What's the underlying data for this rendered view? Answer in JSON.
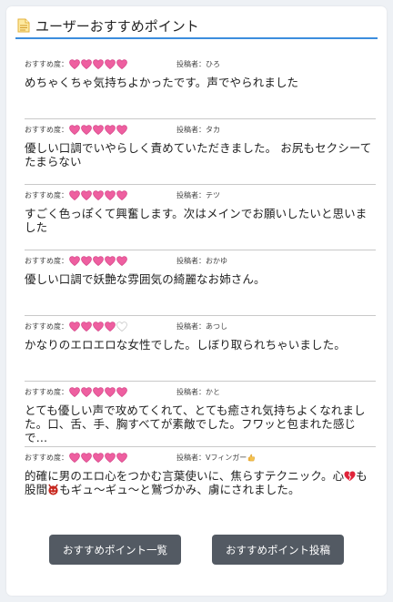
{
  "header": {
    "title": "ユーザーおすすめポイント",
    "icon": "document-icon"
  },
  "colors": {
    "accent": "#3c8dde",
    "heart": "#ee5fa0",
    "button": "#535a63"
  },
  "reviews": [
    {
      "rating_label": "おすすめ度：",
      "rating": 5,
      "poster": "投稿者：ひろ",
      "text": "めちゃくちゃ気持ちよかったです。声でやられました"
    },
    {
      "rating_label": "おすすめ度：",
      "rating": 5,
      "poster": "投稿者：タカ",
      "text": "優しい口調でいやらしく責めていただきました。 お尻もセクシーてたまらない"
    },
    {
      "rating_label": "おすすめ度：",
      "rating": 5,
      "poster": "投稿者：テツ",
      "text": "すごく色っぽくて興奮します。次はメインでお願いしたいと思いました"
    },
    {
      "rating_label": "おすすめ度：",
      "rating": 5,
      "poster": "投稿者：おかゆ",
      "text": "優しい口調で妖艶な雰囲気の綺麗なお姉さん。"
    },
    {
      "rating_label": "おすすめ度：",
      "rating": 4,
      "poster": "投稿者：あつし",
      "text": "かなりのエロエロな女性でした。しぼり取られちゃいました。"
    },
    {
      "rating_label": "おすすめ度：",
      "rating": 5,
      "poster": "投稿者：かと",
      "text": "とても優しい声で攻めてくれて、とても癒され気持ちよくなれました。口、舌、手、胸すべてが素敵でした。フワッと包まれた感じで…"
    },
    {
      "rating_label": "おすすめ度：",
      "rating": 5,
      "poster": "投稿者：Vフィンガー",
      "text_parts": [
        "的確に男のエロ心をつかむ言葉使いに、焦らすテクニック。心",
        "も股間",
        "もギュ～ギュ～と鷲づかみ、虜にされました。"
      ]
    }
  ],
  "buttons": {
    "list_label": "おすすめポイント一覧",
    "post_label": "おすすめポイント投稿"
  }
}
